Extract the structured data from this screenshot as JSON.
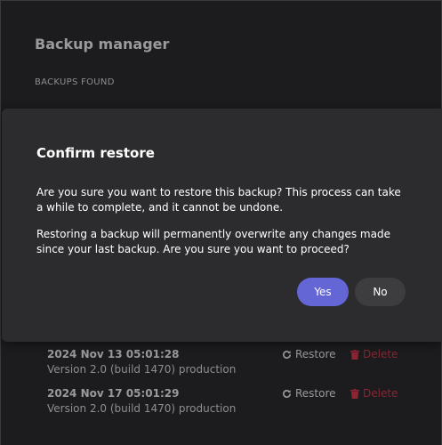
{
  "app": {
    "title": "Backup manager",
    "section_label": "BACKUPS FOUND"
  },
  "backups": [
    {
      "date": "2024 Nov 13 05:01:28",
      "version": "Version 2.0 (build 1470) production",
      "restore_label": "Restore",
      "delete_label": "Delete"
    },
    {
      "date": "2024 Nov 17 05:01:29",
      "version": "Version 2.0 (build 1470) production",
      "restore_label": "Restore",
      "delete_label": "Delete"
    }
  ],
  "dialog": {
    "title": "Confirm restore",
    "paragraph1": "Are you sure you want to restore this backup? This process can take a while to complete, and it cannot be undone.",
    "paragraph2": "Restoring a backup will permanently overwrite any changes made since your last backup. Are you sure you want to proceed?",
    "yes_label": "Yes",
    "no_label": "No"
  },
  "colors": {
    "accent": "#6466d6",
    "danger": "#8b2533",
    "dialog_bg": "#2c2c2e",
    "page_bg": "#1c1c1e"
  },
  "icons": {
    "restore": "restore-icon",
    "delete": "trash-icon"
  }
}
